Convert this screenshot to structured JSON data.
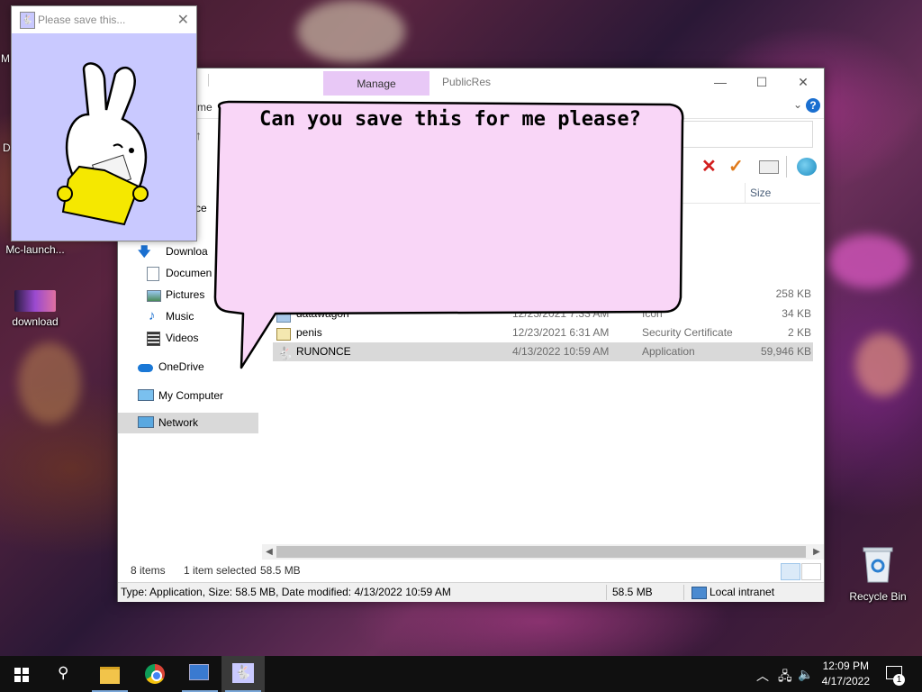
{
  "desktop": {
    "icons": [
      {
        "label": "Mc-launch..."
      },
      {
        "label": "download"
      },
      {
        "label": "Recycle Bin"
      }
    ],
    "edge_fragments": [
      "M",
      "D"
    ]
  },
  "explorer": {
    "tab_manage": "Manage",
    "window_title": "PublicRes",
    "ribbon_fragment": "me",
    "controls": {
      "minimize": "—",
      "maximize": "☐",
      "close": "✕"
    },
    "help": "?",
    "column_size": "Size",
    "nav": [
      {
        "label": "Acce"
      },
      {
        "label": "op"
      },
      {
        "label": "Downloa"
      },
      {
        "label": "Documen"
      },
      {
        "label": "Pictures"
      },
      {
        "label": "Music"
      },
      {
        "label": "Videos"
      },
      {
        "label": "OneDrive"
      },
      {
        "label": "My Computer"
      },
      {
        "label": "Network"
      }
    ],
    "files": [
      {
        "name": "",
        "date": "",
        "type": "r",
        "size": "258 KB"
      },
      {
        "name": "datawagon",
        "date": "12/23/2021 7:33 AM",
        "type": "Icon",
        "size": "34 KB"
      },
      {
        "name": "penis",
        "date": "12/23/2021 6:31 AM",
        "type": "Security Certificate",
        "size": "2 KB"
      },
      {
        "name": "RUNONCE",
        "date": "4/13/2022 10:59 AM",
        "type": "Application",
        "size": "59,946 KB"
      }
    ],
    "hidden_row_fragment": "r",
    "status": {
      "items": "8 items",
      "selected": "1 item selected",
      "selsize": "58.5 MB"
    },
    "details": {
      "info": "Type: Application, Size: 58.5 MB, Date modified: 4/13/2022 10:59 AM",
      "size": "58.5 MB",
      "zone": "Local intranet"
    }
  },
  "popup": {
    "title": "Please save this..."
  },
  "bubble": {
    "text": "Can you save this for me please?"
  },
  "taskbar": {
    "time": "12:09 PM",
    "date": "4/17/2022",
    "notifications": "1"
  },
  "colors": {
    "bubble": "#f9d6f7",
    "popup_bg": "#c9c9ff",
    "manage_tab": "#e8c8f6"
  }
}
